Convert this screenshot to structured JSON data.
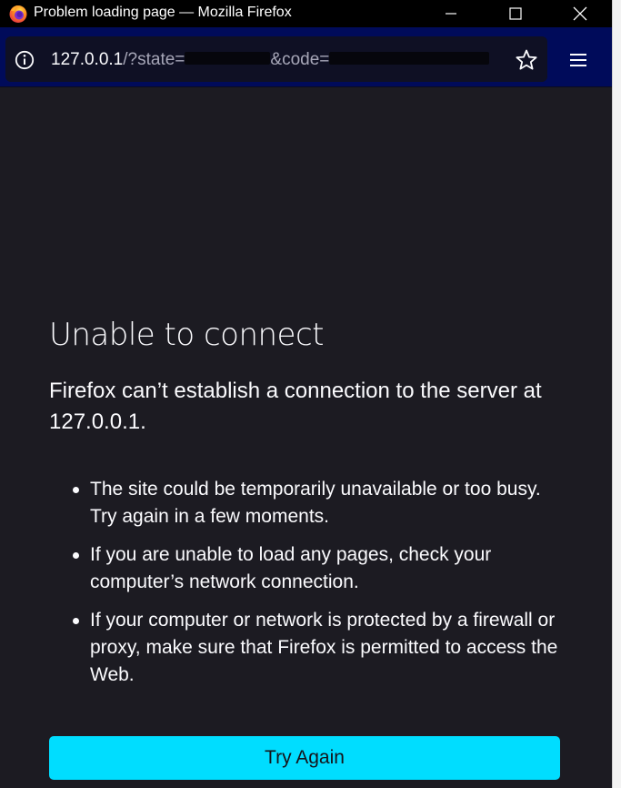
{
  "window": {
    "title": "Problem loading page — Mozilla Firefox",
    "controls": {
      "minimize_icon": "minimize-icon",
      "maximize_icon": "maximize-icon",
      "close_icon": "close-icon"
    }
  },
  "toolbar": {
    "url_host": "127.0.0.1",
    "url_part1": "/?state=",
    "url_part2": "&code=",
    "info_icon": "info-icon",
    "bookmark_icon": "star-icon",
    "menu_icon": "hamburger-menu-icon"
  },
  "error_page": {
    "heading": "Unable to connect",
    "description": "Firefox can’t establish a connection to the server at 127.0.0.1.",
    "bullets": [
      "The site could be temporarily unavailable or too busy. Try again in a few moments.",
      "If you are unable to load any pages, check your computer’s network connection.",
      "If your computer or network is protected by a firewall or proxy, make sure that Firefox is permitted to access the Web."
    ],
    "try_again_label": "Try Again"
  },
  "colors": {
    "titlebar": "#000000",
    "toolbar": "#000b5a",
    "page_background": "#1c1b22",
    "text": "#fbfbfe",
    "accent_button": "#00ddff"
  }
}
